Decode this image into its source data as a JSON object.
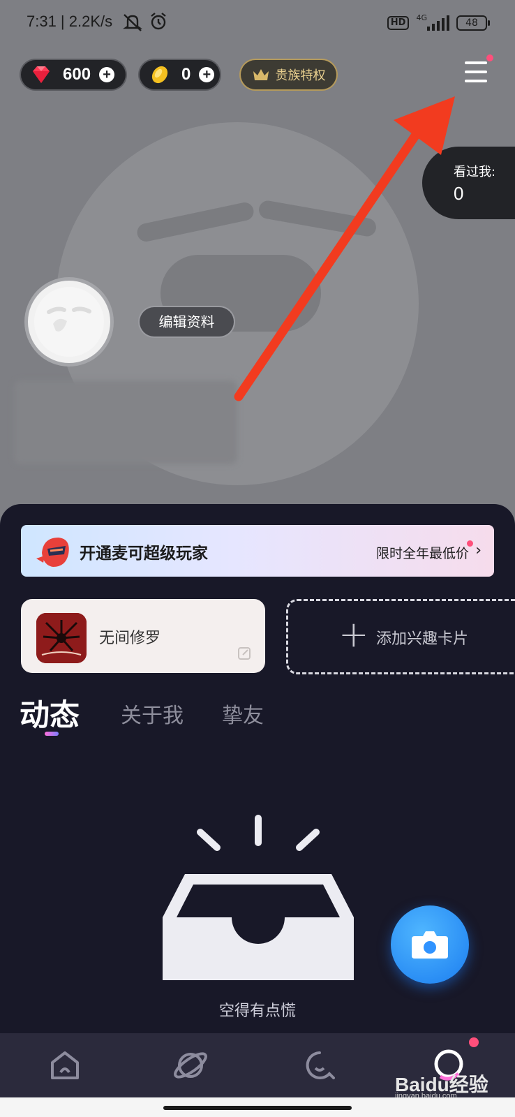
{
  "status_bar": {
    "time": "7:31 | 2.2K/s",
    "network": "4G",
    "hd": "HD",
    "battery": "48"
  },
  "wallet": {
    "diamonds": "600",
    "coins": "0",
    "noble_label": "贵族特权"
  },
  "visitors": {
    "label": "看过我:",
    "count": "0"
  },
  "profile": {
    "edit_label": "编辑资料"
  },
  "promo_banner": {
    "title": "开通麦可超级玩家",
    "subtitle": "限时全年最低价"
  },
  "interest_cards": {
    "game_name": "无间修罗",
    "add_label": "添加兴趣卡片"
  },
  "tabs": [
    {
      "label": "动态",
      "active": true
    },
    {
      "label": "关于我",
      "active": false
    },
    {
      "label": "挚友",
      "active": false
    }
  ],
  "empty_state": {
    "text": "空得有点慌"
  },
  "watermark": {
    "brand": "Baidu经验",
    "site": "jingyan.baidu.com"
  },
  "bottom_nav": [
    {
      "icon": "home-icon"
    },
    {
      "icon": "planet-icon"
    },
    {
      "icon": "chat-bubble-icon"
    },
    {
      "icon": "profile-icon",
      "active": true
    }
  ],
  "colors": {
    "accent_red": "#f23b1f",
    "notification_dot": "#ff4f7b",
    "fab_blue": "#2f93ff",
    "sheet_bg": "#181828"
  }
}
